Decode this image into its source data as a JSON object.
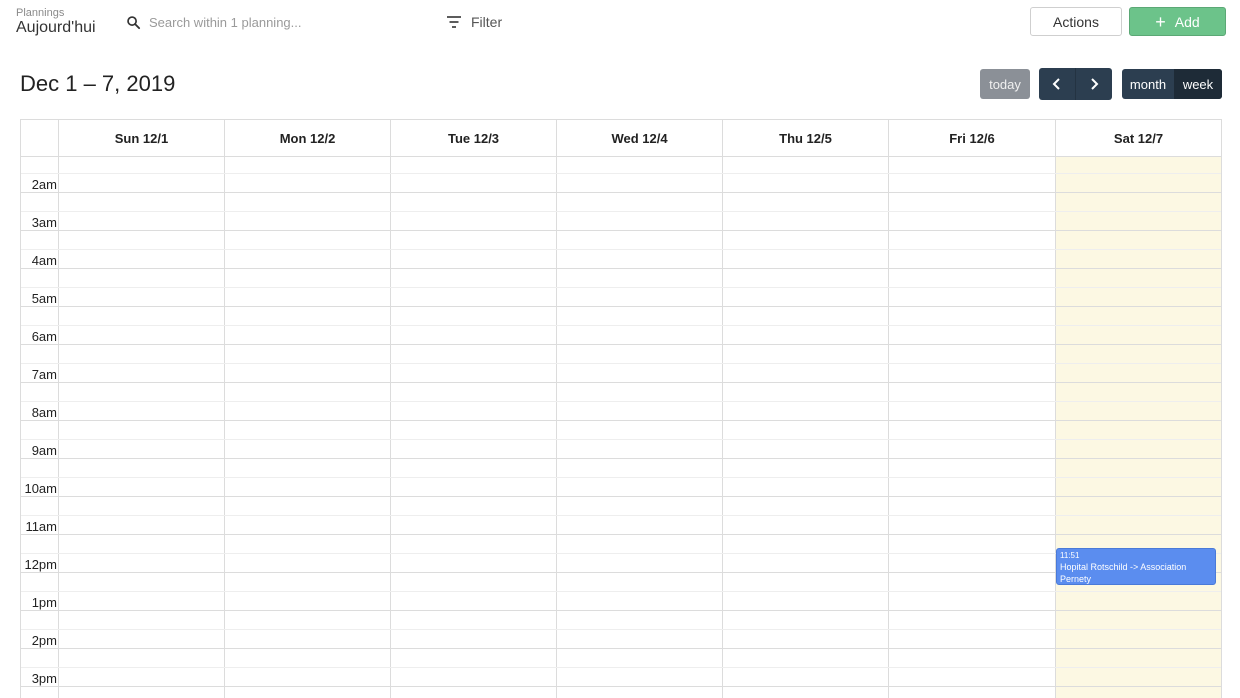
{
  "header": {
    "breadcrumb_label": "Plannings",
    "title": "Aujourd'hui",
    "search_placeholder": "Search within 1 planning...",
    "filter_label": "Filter",
    "actions_label": "Actions",
    "add_label": "Add"
  },
  "toolbar": {
    "title": "Dec 1 – 7, 2019",
    "today_label": "today",
    "month_label": "month",
    "week_label": "week"
  },
  "calendar": {
    "days": [
      "Sun 12/1",
      "Mon 12/2",
      "Tue 12/3",
      "Wed 12/4",
      "Thu 12/5",
      "Fri 12/6",
      "Sat 12/7"
    ],
    "hours": [
      "2am",
      "3am",
      "4am",
      "5am",
      "6am",
      "7am",
      "8am",
      "9am",
      "10am",
      "11am",
      "12pm",
      "1pm",
      "2pm",
      "3pm"
    ],
    "highlight_color": "#fcf8e3",
    "event": {
      "day": "Sat 12/7",
      "time": "11:51",
      "title": "Hopital Rotschild -> Association Pernety",
      "color": "#5b8def"
    }
  },
  "colors": {
    "add_button": "#6cc38a",
    "dark_button": "#2c3e50",
    "today_button": "#8b9097"
  }
}
